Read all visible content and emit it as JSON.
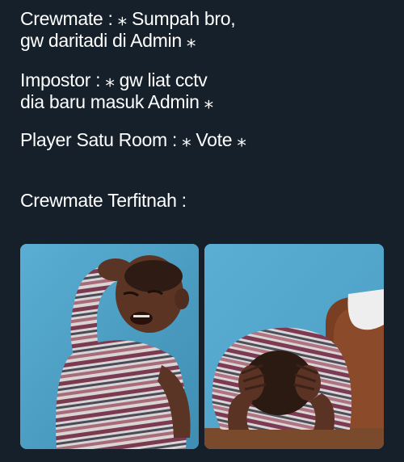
{
  "captions": [
    {
      "lines": [
        "Crewmate : ⁎ Sumpah bro,",
        "gw daritadi di Admin ⁎"
      ]
    },
    {
      "lines": [
        "Impostor : ⁎ gw liat cctv",
        "dia baru masuk Admin ⁎"
      ]
    },
    {
      "lines": [
        "Player Satu Room : ⁎ Vote ⁎"
      ]
    },
    {
      "lines": [
        "Crewmate Terfitnah :"
      ]
    }
  ],
  "images": {
    "left": {
      "subject": "crying-kid-photo"
    },
    "right": {
      "subject": "kid-holding-head-photo"
    }
  },
  "colors": {
    "background": "#15202b",
    "text": "#ffffff",
    "wall": "#4fa0c5"
  }
}
